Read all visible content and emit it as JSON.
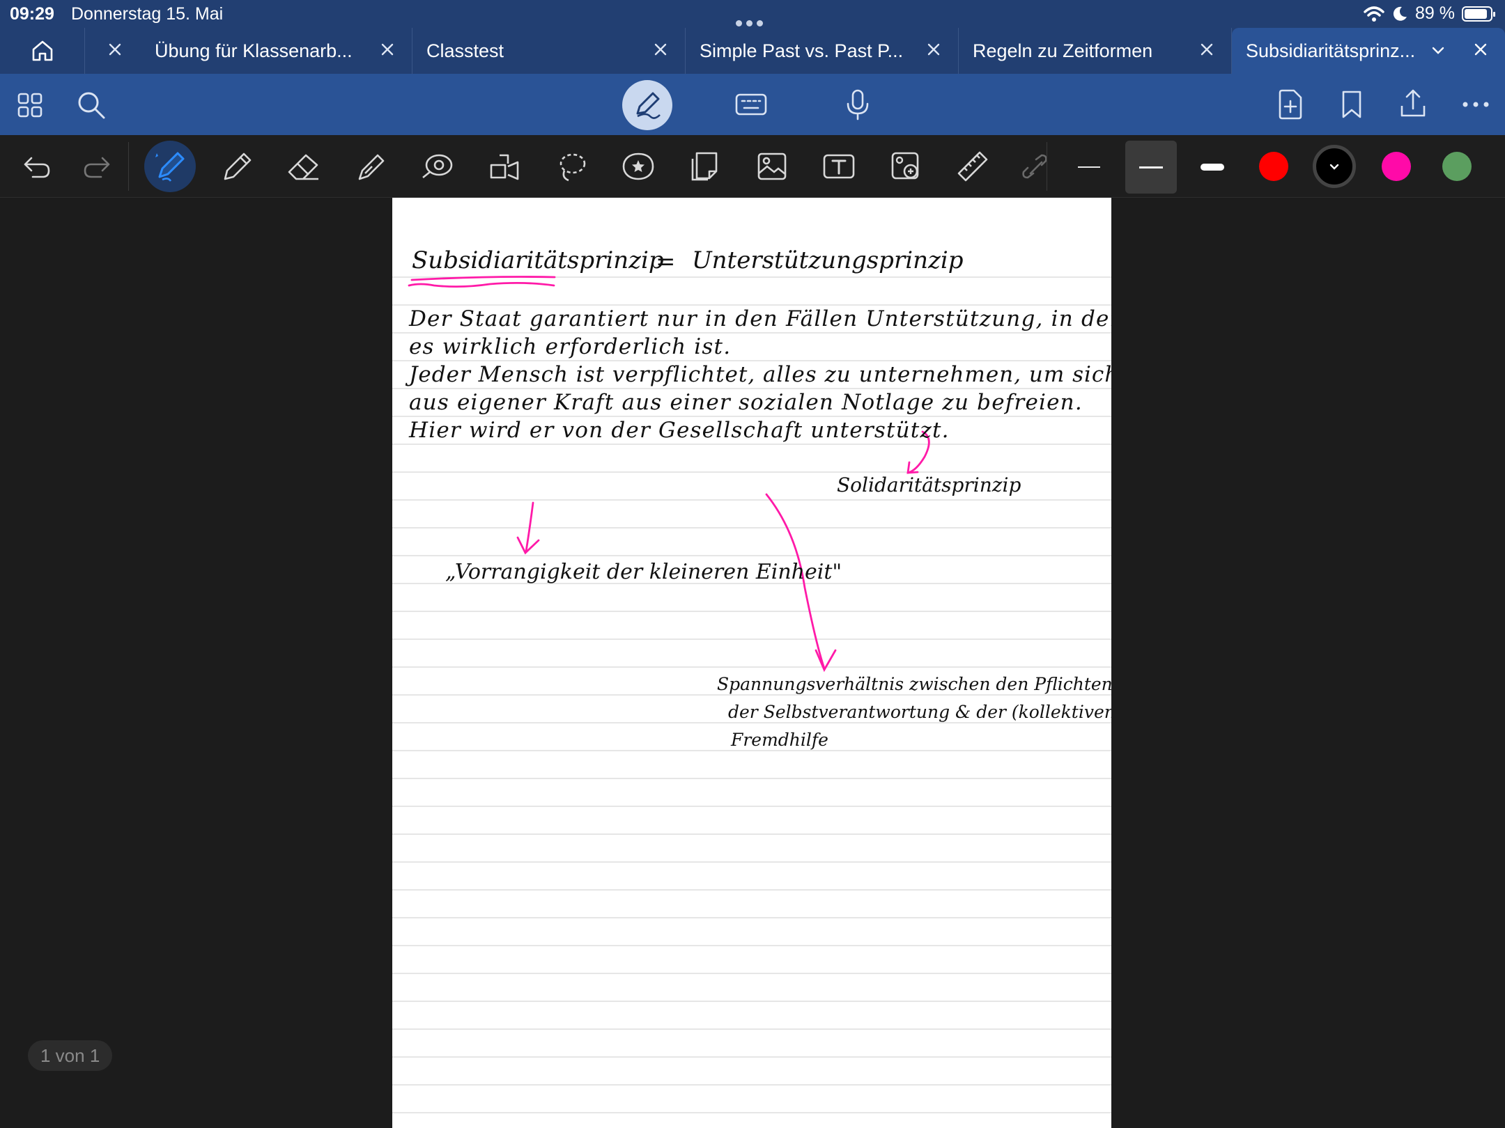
{
  "status_bar": {
    "time": "09:29",
    "date": "Donnerstag 15. Mai",
    "battery": "89 %",
    "battery_level": 0.89
  },
  "tabs": [
    {
      "label": "Übung für Klassenarb..."
    },
    {
      "label": "Classtest"
    },
    {
      "label": "Simple Past vs. Past P..."
    },
    {
      "label": "Regeln zu Zeitformen"
    },
    {
      "label": "Subsidiaritätsprinz..."
    }
  ],
  "toolbar": {
    "icons": [
      "grid-icon",
      "search-icon",
      "pen-mode-icon",
      "keyboard-icon",
      "microphone-icon",
      "new-page-icon",
      "bookmark-icon",
      "share-icon",
      "more-icon"
    ]
  },
  "tools": {
    "names": [
      "undo-icon",
      "redo-icon",
      "fountain-pen-icon",
      "pencil-icon",
      "eraser-icon",
      "highlighter-icon",
      "shape-icon",
      "element-icon",
      "lasso-icon",
      "sticker-icon",
      "note-icon",
      "image-icon",
      "text-icon",
      "camera-icon",
      "ruler-icon",
      "link-icon"
    ],
    "colors": [
      "#ff0000",
      "#000000",
      "#ff0aa8",
      "#5b9e5f"
    ],
    "selected_color": "#000000"
  },
  "note": {
    "title": "Subsidiaritätsprinzip",
    "equals": "=",
    "title_definition": "Unterstützungsprinzip",
    "paragraph_lines": [
      "Der Staat garantiert nur in den Fällen Unterstützung, in denen",
      "es wirklich erforderlich ist.",
      "Jeder Mensch ist verpflichtet, alles zu unternehmen, um sich",
      "aus eigener Kraft aus einer sozialen Notlage zu befreien.",
      "Hier wird er von der Gesellschaft unterstützt."
    ],
    "arrow_note": "Solidaritätsprinzip",
    "subsidiarity_note": "„Vorrangigkeit der kleineren Einheit\"",
    "tension_lines": [
      "Spannungsverhältnis zwischen den Pflichten",
      "der Selbstverantwortung & der (kollektiven)",
      "Fremdhilfe"
    ]
  },
  "page_counter": "1 von 1"
}
